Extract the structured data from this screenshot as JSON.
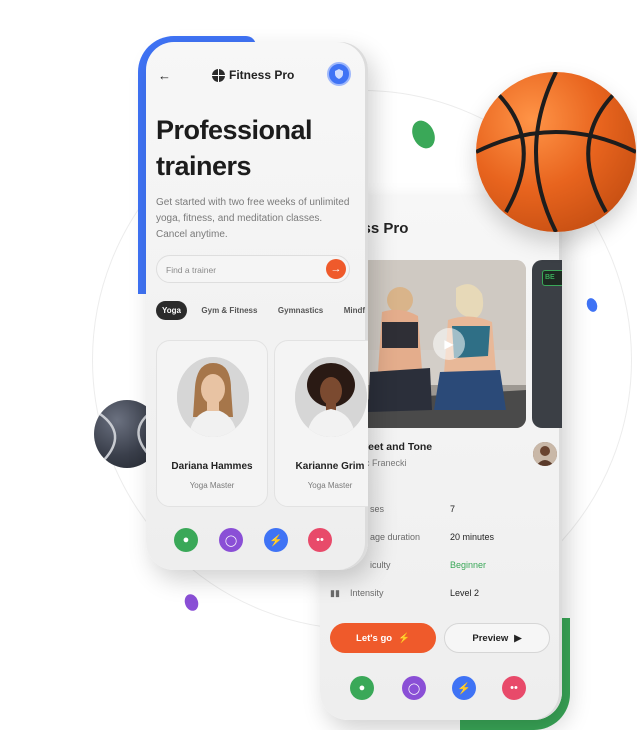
{
  "colors": {
    "accent_blue": "#3f73f5",
    "accent_green": "#3aa858",
    "accent_orange": "#ef5a2b",
    "accent_purple": "#8a4fd6",
    "accent_pink": "#e84a6a"
  },
  "front_phone": {
    "back_icon": "arrow-left-icon",
    "app_name": "Fitness Pro",
    "hero_title": "Professional trainers",
    "hero_description": "Get started with two free weeks of unlimited yoga, fitness, and meditation classes. Cancel anytime.",
    "search": {
      "placeholder": "Find a trainer",
      "button_icon": "arrow-right-icon"
    },
    "tabs": [
      {
        "label": "Yoga",
        "active": true
      },
      {
        "label": "Gym & Fitness",
        "active": false
      },
      {
        "label": "Gymnastics",
        "active": false
      },
      {
        "label": "Mindf",
        "active": false
      }
    ],
    "trainers": [
      {
        "name": "Dariana Hammes",
        "role": "Yoga Master"
      },
      {
        "name": "Karianne Grim",
        "role": "Yoga Master"
      }
    ],
    "bottom_nav": [
      "user-icon",
      "medal-icon",
      "bolt-icon",
      "footprints-icon"
    ]
  },
  "back_phone": {
    "app_name": "tness Pro",
    "video_badge": "BE",
    "class_title": "weet and Tone",
    "class_author": "ric Franecki",
    "stats": [
      {
        "label": "ses",
        "value": "7"
      },
      {
        "label": "age duration",
        "value": "20 minutes"
      },
      {
        "label": "iculty",
        "value": "Beginner"
      },
      {
        "label": "Intensity",
        "value": "Level 2"
      }
    ],
    "buttons": {
      "primary": "Let's go",
      "secondary": "Preview"
    },
    "bottom_nav": [
      "user-icon",
      "medal-icon",
      "bolt-icon",
      "footprints-icon"
    ]
  }
}
